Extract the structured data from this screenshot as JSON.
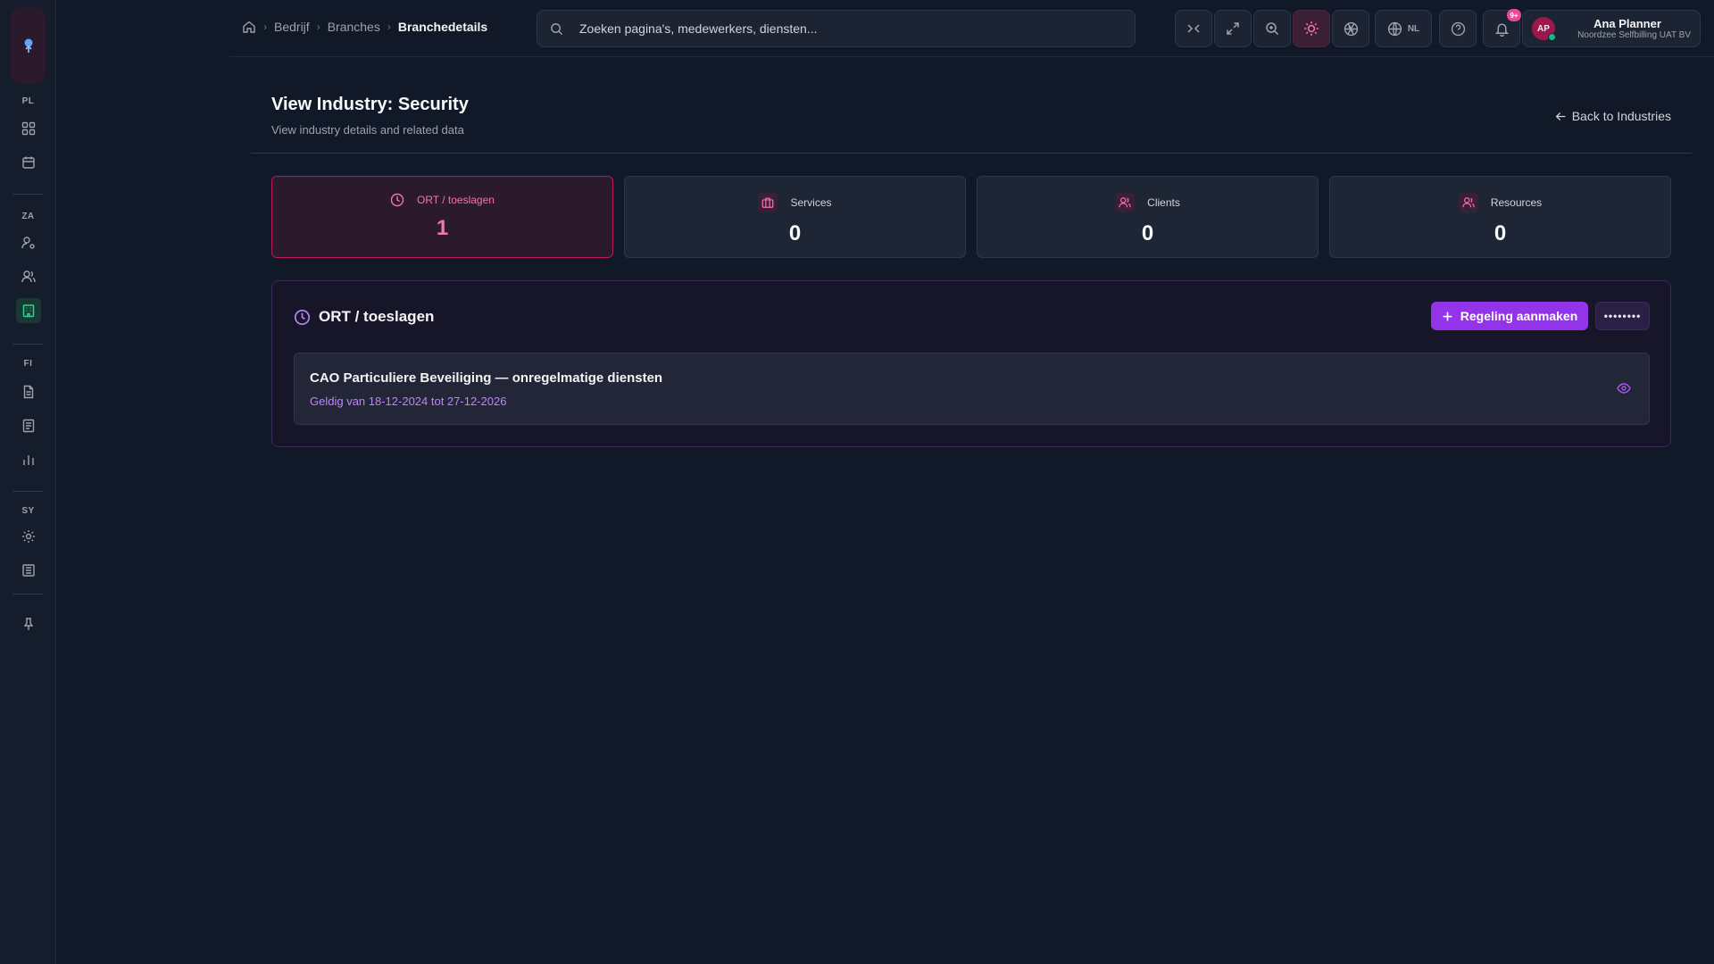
{
  "sidebar": {
    "sections": [
      {
        "label": "PL"
      },
      {
        "label": "ZA"
      },
      {
        "label": "FI"
      },
      {
        "label": "SY"
      }
    ]
  },
  "breadcrumb": {
    "items": [
      "Bedrijf",
      "Branches"
    ],
    "current": "Branchedetails"
  },
  "search": {
    "placeholder": "Zoeken pagina's, medewerkers, diensten..."
  },
  "toolbar": {
    "language": "NL",
    "notification_count": "9+"
  },
  "user": {
    "initials": "AP",
    "name": "Ana Planner",
    "organization": "Noordzee Selfbilling UAT BV"
  },
  "page": {
    "title": "View Industry: Security",
    "subtitle": "View industry details and related data",
    "back_label": "Back to Industries"
  },
  "stats": [
    {
      "label": "ORT / toeslagen",
      "value": "1"
    },
    {
      "label": "Services",
      "value": "0"
    },
    {
      "label": "Clients",
      "value": "0"
    },
    {
      "label": "Resources",
      "value": "0"
    }
  ],
  "section": {
    "title": "ORT / toeslagen",
    "create_label": "Regeling aanmaken",
    "more_label": "••••••••",
    "items": [
      {
        "name": "CAO Particuliere Beveiliging — onregelmatige diensten",
        "validity": "Geldig van 18-12-2024 tot 27-12-2026"
      }
    ]
  },
  "colors": {
    "background": "#111827",
    "accent_pink": "#f472b6",
    "accent_purple": "#9333ea",
    "active_green": "#34d399"
  }
}
